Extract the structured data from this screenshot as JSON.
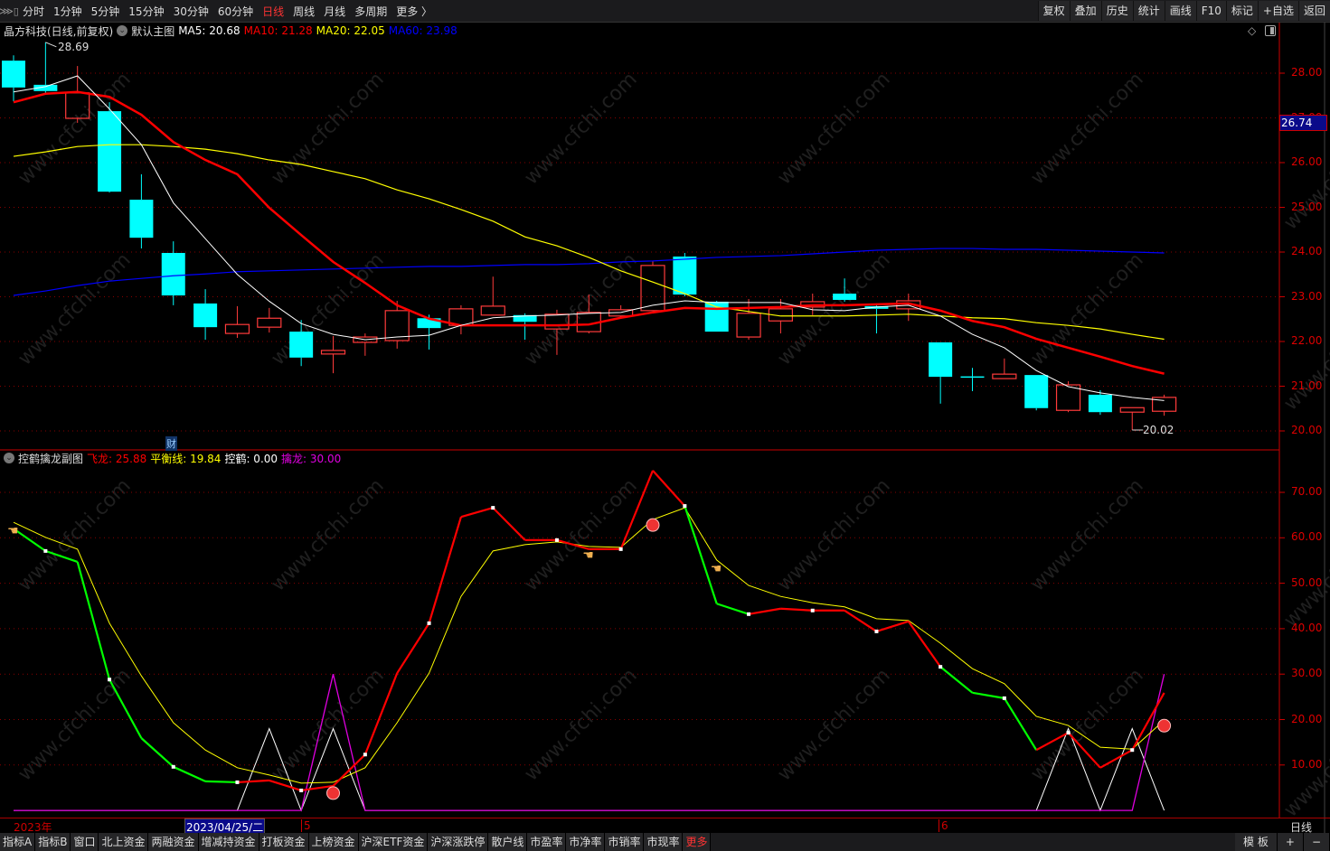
{
  "toolbar": {
    "periods": [
      "分时",
      "1分钟",
      "5分钟",
      "15分钟",
      "30分钟",
      "60分钟",
      "日线",
      "周线",
      "月线",
      "多周期",
      "更多 〉"
    ],
    "active_period": "日线",
    "right_buttons": [
      "复权",
      "叠加",
      "历史",
      "统计",
      "画线",
      "F10",
      "标记",
      "+自选",
      "返回"
    ]
  },
  "main_legend": {
    "stock": "晶方科技(日线,前复权)",
    "template": "默认主图",
    "ma5": "MA5: 20.68",
    "ma10": "MA10: 21.28",
    "ma20": "MA20: 22.05",
    "ma60": "MA60: 23.98"
  },
  "sub_legend": {
    "title": "控鹤擒龙副图",
    "feilong": "飞龙: 25.88",
    "pingheng": "平衡线: 19.84",
    "konghe": "控鹤: 0.00",
    "qinlong": "擒龙: 30.00"
  },
  "colors": {
    "up": "#ff3b3b",
    "down": "#00ffff",
    "ma5": "#ffffff",
    "ma10": "#ff0000",
    "ma20": "#ffff00",
    "ma60": "#0000ff",
    "feilong_up": "#ff0000",
    "feilong_down": "#00ff00",
    "pingheng": "#ffff00",
    "konghe": "#ffffff",
    "qinlong": "#e000e0",
    "axis": "#cc0000"
  },
  "price_axis": {
    "labels": [
      "28.00",
      "27.00",
      "26.00",
      "25.00",
      "24.00",
      "23.00",
      "22.00",
      "21.00",
      "20.00"
    ],
    "current": "26.74",
    "range": [
      20,
      28
    ]
  },
  "sub_axis": {
    "labels": [
      "70.00",
      "60.00",
      "50.00",
      "40.00",
      "30.00",
      "20.00",
      "10.00"
    ],
    "range": [
      0,
      70
    ]
  },
  "annotations": {
    "high": "28.69",
    "low": "20.02",
    "finance_marker": "财"
  },
  "chart_data": {
    "type": "candlestick",
    "candles": [
      [
        28.28,
        27.68,
        28.4,
        27.37
      ],
      [
        27.74,
        27.6,
        28.69,
        27.52
      ],
      [
        26.99,
        27.56,
        28.16,
        26.89
      ],
      [
        27.15,
        25.35,
        27.35,
        25.33
      ],
      [
        25.17,
        24.32,
        25.74,
        24.08
      ],
      [
        23.98,
        23.03,
        24.24,
        22.81
      ],
      [
        22.85,
        22.32,
        23.17,
        22.04
      ],
      [
        22.18,
        22.38,
        22.79,
        22.08
      ],
      [
        22.32,
        22.52,
        22.75,
        22.2
      ],
      [
        22.22,
        21.64,
        22.48,
        21.45
      ],
      [
        21.72,
        21.8,
        22.12,
        21.29
      ],
      [
        21.98,
        22.1,
        22.18,
        21.68
      ],
      [
        22.02,
        22.69,
        22.91,
        21.84
      ],
      [
        22.52,
        22.3,
        22.6,
        21.82
      ],
      [
        22.36,
        22.73,
        22.81,
        22.16
      ],
      [
        22.59,
        22.79,
        23.45,
        22.59
      ],
      [
        22.59,
        22.44,
        22.63,
        22.04
      ],
      [
        22.28,
        22.61,
        22.71,
        21.7
      ],
      [
        22.22,
        22.65,
        23.05,
        22.18
      ],
      [
        22.57,
        22.71,
        22.81,
        22.53
      ],
      [
        22.69,
        23.7,
        23.8,
        22.69
      ],
      [
        23.9,
        23.05,
        23.98,
        23.01
      ],
      [
        22.89,
        22.22,
        22.91,
        22.22
      ],
      [
        22.1,
        22.63,
        22.95,
        22.04
      ],
      [
        22.46,
        22.73,
        22.95,
        22.18
      ],
      [
        22.77,
        22.89,
        23.07,
        22.59
      ],
      [
        23.07,
        22.93,
        23.41,
        22.89
      ],
      [
        22.79,
        22.73,
        22.83,
        22.18
      ],
      [
        22.73,
        22.91,
        23.07,
        22.46
      ],
      [
        21.98,
        21.21,
        21.98,
        20.61
      ],
      [
        21.22,
        21.19,
        21.41,
        20.89
      ],
      [
        21.17,
        21.27,
        21.62,
        21.17
      ],
      [
        21.25,
        20.51,
        21.25,
        20.46
      ],
      [
        20.46,
        21.03,
        21.11,
        20.42
      ],
      [
        20.81,
        20.42,
        20.91,
        20.36
      ],
      [
        20.42,
        20.52,
        20.52,
        20.02
      ],
      [
        20.44,
        20.75,
        20.81,
        20.34
      ]
    ],
    "candle_format": [
      "open",
      "close",
      "high",
      "low"
    ],
    "ma5": [
      27.58,
      27.7,
      27.94,
      27.2,
      26.4,
      25.1,
      24.3,
      23.5,
      22.9,
      22.4,
      22.16,
      22.04,
      22.1,
      22.14,
      22.36,
      22.53,
      22.57,
      22.59,
      22.63,
      22.65,
      22.81,
      22.91,
      22.87,
      22.87,
      22.87,
      22.71,
      22.69,
      22.77,
      22.81,
      22.57,
      22.16,
      21.86,
      21.35,
      20.99,
      20.85,
      20.75,
      20.68
    ],
    "ma10": [
      27.35,
      27.54,
      27.58,
      27.47,
      27.07,
      26.46,
      26.06,
      25.74,
      24.99,
      24.38,
      23.78,
      23.31,
      22.81,
      22.51,
      22.36,
      22.36,
      22.36,
      22.36,
      22.38,
      22.53,
      22.65,
      22.75,
      22.73,
      22.75,
      22.77,
      22.81,
      22.81,
      22.83,
      22.85,
      22.69,
      22.46,
      22.32,
      22.06,
      21.86,
      21.66,
      21.45,
      21.28
    ],
    "ma20": [
      26.14,
      26.24,
      26.36,
      26.4,
      26.4,
      26.36,
      26.3,
      26.2,
      26.06,
      25.96,
      25.8,
      25.64,
      25.39,
      25.19,
      24.95,
      24.69,
      24.34,
      24.14,
      23.88,
      23.58,
      23.33,
      23.07,
      22.77,
      22.67,
      22.57,
      22.57,
      22.57,
      22.59,
      22.61,
      22.57,
      22.53,
      22.51,
      22.42,
      22.36,
      22.28,
      22.16,
      22.05
    ],
    "ma60": [
      23.03,
      23.13,
      23.25,
      23.35,
      23.41,
      23.47,
      23.51,
      23.56,
      23.58,
      23.6,
      23.62,
      23.64,
      23.66,
      23.68,
      23.68,
      23.7,
      23.72,
      23.72,
      23.74,
      23.78,
      23.8,
      23.84,
      23.88,
      23.9,
      23.92,
      23.96,
      24.0,
      24.04,
      24.06,
      24.08,
      24.08,
      24.06,
      24.06,
      24.04,
      24.02,
      24.0,
      23.98
    ],
    "feilong": [
      62.0,
      57.1,
      54.7,
      28.8,
      15.9,
      9.6,
      6.4,
      6.2,
      6.6,
      4.4,
      5.4,
      12.3,
      30.2,
      41.2,
      64.6,
      66.6,
      59.5,
      59.5,
      57.5,
      57.5,
      74.8,
      67.0,
      45.5,
      43.2,
      44.4,
      44.0,
      44.0,
      39.4,
      41.6,
      31.6,
      25.9,
      24.7,
      13.3,
      17.1,
      9.4,
      13.3,
      25.88
    ],
    "feilong_segment_state": [
      "down",
      "down",
      "down",
      "down",
      "down",
      "down",
      "down",
      "up",
      "up",
      "up",
      "up",
      "up",
      "up",
      "up",
      "up",
      "up",
      "up",
      "up",
      "up",
      "up",
      "up",
      "down",
      "down",
      "up",
      "up",
      "up",
      "up",
      "up",
      "up",
      "down",
      "down",
      "down",
      "up",
      "up",
      "up",
      "up"
    ],
    "pingheng": [
      63.4,
      60.1,
      57.5,
      41.2,
      29.6,
      19.3,
      13.3,
      9.4,
      7.8,
      6.0,
      6.2,
      9.4,
      19.3,
      30.2,
      47.1,
      57.1,
      58.5,
      59.1,
      58.1,
      57.9,
      64.0,
      66.6,
      55.1,
      49.5,
      47.1,
      45.7,
      44.8,
      42.2,
      41.8,
      36.8,
      31.2,
      27.9,
      20.7,
      18.7,
      13.9,
      13.5,
      19.84
    ],
    "konghe": [
      0,
      0,
      0,
      0,
      0,
      0,
      0,
      0,
      18,
      0,
      18,
      0,
      0,
      0,
      0,
      0,
      0,
      0,
      0,
      0,
      0,
      0,
      0,
      0,
      0,
      0,
      0,
      0,
      0,
      0,
      0,
      0,
      0,
      18,
      0,
      18,
      0
    ],
    "qinlong": [
      0,
      0,
      0,
      0,
      0,
      0,
      0,
      0,
      0,
      0,
      30,
      0,
      0,
      0,
      0,
      0,
      0,
      0,
      0,
      0,
      0,
      0,
      0,
      0,
      0,
      0,
      0,
      0,
      0,
      0,
      0,
      0,
      0,
      0,
      0,
      0,
      30
    ],
    "hand_signals": [
      0,
      18,
      22
    ],
    "ball_signals": [
      10,
      20,
      36
    ]
  },
  "date_axis": {
    "year": "2023年",
    "cursor_date": "2023/04/25/二",
    "month_may": "5",
    "month_june": "6",
    "period": "日线"
  },
  "bottom_tabs": [
    "指标A",
    "指标B",
    "窗口",
    "北上资金",
    "两融资金",
    "增减持资金",
    "打板资金",
    "上榜资金",
    "沪深ETF资金",
    "沪深涨跌停",
    "散户线",
    "市盈率",
    "市净率",
    "市销率",
    "市现率",
    "更多"
  ],
  "bottom_right": {
    "template": "模 板",
    "zoom_in": "+",
    "zoom_out": "−"
  },
  "watermark": "www.cfchi.com"
}
